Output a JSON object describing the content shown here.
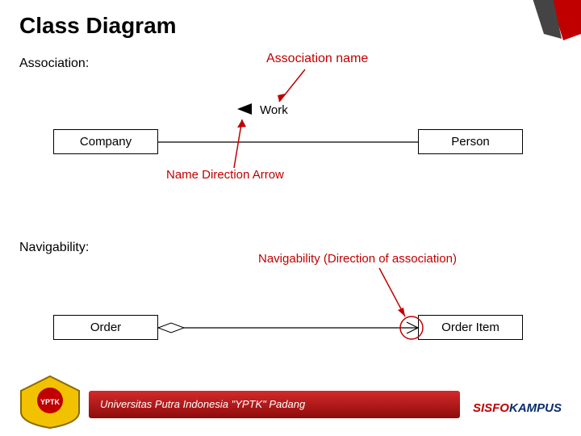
{
  "title": "Class Diagram",
  "section1_label": "Association:",
  "assoc_name": "Association name",
  "work_label": "Work",
  "boxes": {
    "company": "Company",
    "person": "Person",
    "order": "Order",
    "order_item": "Order Item"
  },
  "name_direction": "Name Direction Arrow",
  "section2_label": "Navigability:",
  "navig_desc": "Navigability (Direction of association)",
  "footer": {
    "university": "Universitas Putra Indonesia \"YPTK\" Padang",
    "brand_left": "SISFO",
    "brand_right": "KAMPUS"
  },
  "colors": {
    "accent_red": "#c00000",
    "bar_gradient_top": "#d42a2a",
    "bar_gradient_bottom": "#8e0b0b",
    "navy": "#0b2e6f"
  }
}
